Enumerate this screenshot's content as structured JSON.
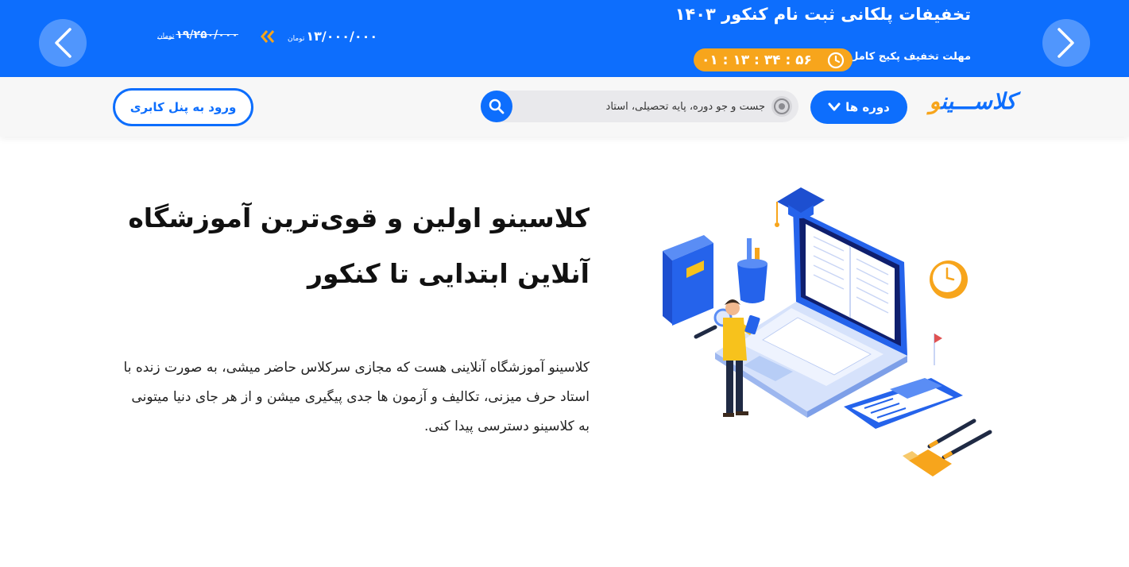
{
  "promo": {
    "title": "تخفیفات پلکانی ثبت نام کنکور ۱۴۰۳",
    "deadline_label": "مهلت تخفیف پکیج کامل",
    "countdown": "۰۱ : ۱۳ : ۳۴ : ۵۶",
    "new_price": "۱۳/۰۰۰/۰۰۰",
    "new_price_unit": "تومان",
    "old_price": "۱۹/۲۵۰/۰۰۰",
    "old_price_unit": "تومان"
  },
  "header": {
    "logo_main": "کلاســـین",
    "logo_accent": "و",
    "courses_label": "دوره ها",
    "search_placeholder": "جست و جو دوره، پایه تحصیلی، استاد",
    "login_label": "ورود به پنل کابری"
  },
  "hero": {
    "title_line1": "کلاسینو اولین و قوی‌ترین آموزشگاه",
    "title_line2": "آنلاین ابتدایی تا کنکور",
    "description": "کلاسینو آموزشگاه آنلاینی هست که مجازی سرکلاس حاضر میشی، به صورت زنده با استاد حرف میزنی، تکالیف و آزمون ها جدی پیگیری میشن و از هر جای دنیا میتونی به کلاسینو دسترسی پیدا کنی."
  },
  "colors": {
    "primary": "#0d6efd",
    "accent": "#f7a51c",
    "header_bg": "#f7f7f7"
  },
  "icons": {
    "prev": "chevron-left-icon",
    "next": "chevron-right-icon",
    "clock": "clock-icon",
    "search": "search-icon",
    "target": "target-icon",
    "dropdown": "chevron-down-icon",
    "price_arrows": "double-chevron-left-icon"
  }
}
